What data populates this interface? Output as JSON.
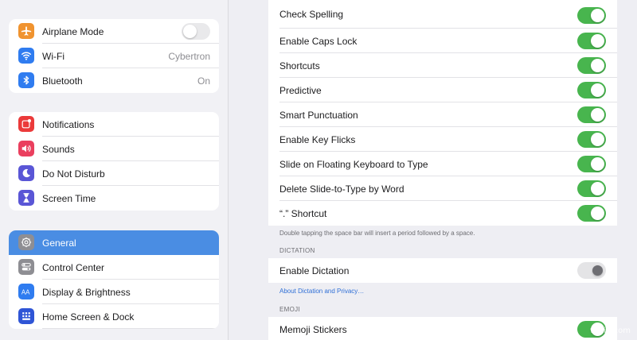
{
  "sidebar": {
    "group1": [
      {
        "label": "Airplane Mode",
        "icon": "airplane-icon",
        "color": "#f0932f",
        "control": "toggle-off"
      },
      {
        "label": "Wi-Fi",
        "icon": "wifi-icon",
        "color": "#2f7cf0",
        "value": "Cybertron"
      },
      {
        "label": "Bluetooth",
        "icon": "bluetooth-icon",
        "color": "#2f7cf0",
        "value": "On"
      }
    ],
    "group2": [
      {
        "label": "Notifications",
        "icon": "notifications-icon",
        "color": "#eb3a3a"
      },
      {
        "label": "Sounds",
        "icon": "speaker-icon",
        "color": "#ea3f5e"
      },
      {
        "label": "Do Not Disturb",
        "icon": "moon-icon",
        "color": "#5a56d6"
      },
      {
        "label": "Screen Time",
        "icon": "hourglass-icon",
        "color": "#5a56d6"
      }
    ],
    "group3": [
      {
        "label": "General",
        "icon": "gear-icon",
        "color": "#8e8e93",
        "selected": true
      },
      {
        "label": "Control Center",
        "icon": "switches-icon",
        "color": "#8e8e93"
      },
      {
        "label": "Display & Brightness",
        "icon": "text-size-icon",
        "color": "#2f7cf0"
      },
      {
        "label": "Home Screen & Dock",
        "icon": "grid-icon",
        "color": "#2f55d6"
      }
    ]
  },
  "keyboard_settings": [
    {
      "label": "Check Spelling",
      "on": true
    },
    {
      "label": "Enable Caps Lock",
      "on": true
    },
    {
      "label": "Shortcuts",
      "on": true
    },
    {
      "label": "Predictive",
      "on": true
    },
    {
      "label": "Smart Punctuation",
      "on": true
    },
    {
      "label": "Enable Key Flicks",
      "on": true
    },
    {
      "label": "Slide on Floating Keyboard to Type",
      "on": true
    },
    {
      "label": "Delete Slide-to-Type by Word",
      "on": true
    },
    {
      "label": "“.” Shortcut",
      "on": true
    }
  ],
  "period_footnote": "Double tapping the space bar will insert a period followed by a space.",
  "dictation": {
    "header": "DICTATION",
    "label": "Enable Dictation",
    "on": false,
    "link": "About Dictation and Privacy…"
  },
  "emoji": {
    "header": "EMOJI",
    "label": "Memoji Stickers",
    "on": true
  },
  "watermark": "wfyid.com",
  "colors": {
    "toggle_on": "#48b54e",
    "selection": "#4a8de3",
    "link": "#2f6fd6"
  }
}
